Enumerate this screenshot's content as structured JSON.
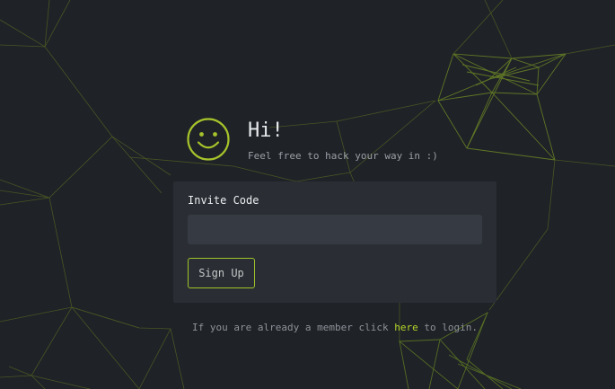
{
  "header": {
    "title": "Hi!",
    "subtitle": "Feel free to hack your way in :)"
  },
  "form": {
    "invite_label": "Invite Code",
    "invite_value": "",
    "signup_label": "Sign Up"
  },
  "footer": {
    "prefix": "If you are already a member click ",
    "link_text": "here",
    "suffix": " to login."
  },
  "theme": {
    "background": "#1f2227",
    "accent": "#a6c32b",
    "card": "#2a2e34",
    "input": "#363b43"
  },
  "icons": {
    "logo": "smiley-icon",
    "background": "polygon-network-pattern"
  }
}
